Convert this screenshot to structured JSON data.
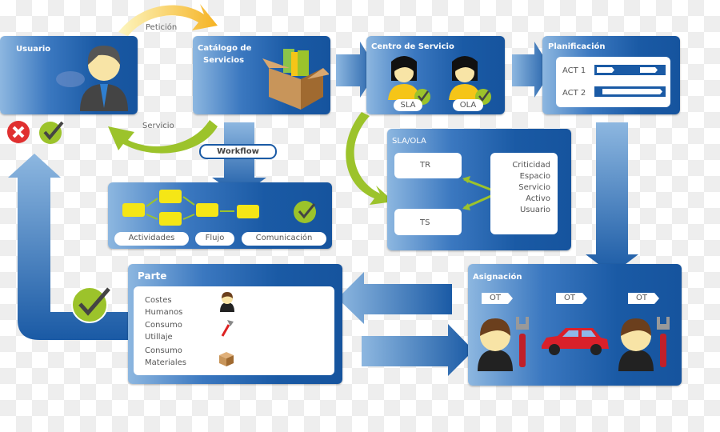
{
  "usuario": {
    "title": "Usuario"
  },
  "flow": {
    "peticion": "Petición",
    "servicio": "Servicio"
  },
  "catalogo": {
    "title_line1": "Catálogo de",
    "title_line2": "Servicios"
  },
  "workflow": {
    "label": "Workflow",
    "pills": [
      "Actividades",
      "Flujo",
      "Comunicación"
    ]
  },
  "centro": {
    "title": "Centro de Servicio",
    "agents": [
      "SLA",
      "OLA"
    ]
  },
  "planificacion": {
    "title": "Planificación",
    "rows": [
      "ACT 1",
      "ACT 2"
    ]
  },
  "sla_ola": {
    "title": "SLA/OLA",
    "tr": "TR",
    "ts": "TS",
    "factors": [
      "Criticidad",
      "Espacio",
      "Servicio",
      "Activo",
      "Usuario"
    ],
    "plus": "+"
  },
  "parte": {
    "title": "Parte",
    "items": [
      [
        "Costes",
        "Humanos"
      ],
      [
        "Consumo",
        "Utillaje"
      ],
      [
        "Consumo",
        "Materiales"
      ]
    ]
  },
  "asignacion": {
    "title": "Asignación",
    "tags": [
      "OT",
      "OT",
      "OT"
    ]
  },
  "colors": {
    "blue": "#1a5aa5",
    "green": "#9cc32b",
    "yellow": "#f5e616",
    "orange": "#f5b324"
  }
}
